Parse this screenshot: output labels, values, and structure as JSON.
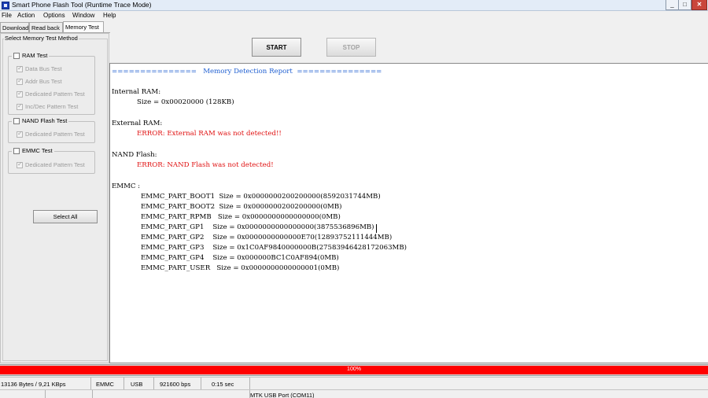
{
  "window": {
    "title": "Smart Phone Flash Tool (Runtime Trace Mode)",
    "minimize": "_",
    "maximize": "□",
    "close": "✕"
  },
  "menu": [
    "File",
    "Action",
    "Options",
    "Window",
    "Help"
  ],
  "tabs": [
    "Download",
    "Read back",
    "Memory Test"
  ],
  "left_panel": {
    "caption": "Select Memory Test Method",
    "ram_test": {
      "label": "RAM Test",
      "options": [
        "Data Bus Test",
        "Addr Bus Test",
        "Dedicated Pattern Test",
        "Inc/Dec Pattern Test"
      ]
    },
    "nand_test": {
      "label": "NAND Flash Test",
      "options": [
        "Dedicated Pattern Test"
      ]
    },
    "emmc_test": {
      "label": "EMMC Test",
      "options": [
        "Dedicated Pattern Test"
      ]
    },
    "select_all": "Select All"
  },
  "toolbar": {
    "start": "START",
    "stop": "STOP"
  },
  "report": {
    "header": "===============   Memory Detection Report  ===============",
    "internal_ram_label": "Internal RAM:",
    "internal_ram_size": "Size = 0x00020000 (128KB)",
    "external_ram_label": "External RAM:",
    "external_ram_error": "ERROR: External RAM was not detected!!",
    "nand_label": "NAND Flash:",
    "nand_error": "ERROR: NAND Flash was not detected!",
    "emmc_label": "EMMC :",
    "emmc_partitions": [
      "EMMC_PART_BOOT1  Size = 0x0000000200200000(8592031744MB)",
      "EMMC_PART_BOOT2  Size = 0x0000000200200000(0MB)",
      "EMMC_PART_RPMB   Size = 0x0000000000000000(0MB)",
      "EMMC_PART_GP1    Size = 0x0000000000000000(3875536896MB)",
      "EMMC_PART_GP2    Size = 0x0000000000000E70(12893752111444MB)",
      "EMMC_PART_GP3    Size = 0x1C0AF9840000000B(27583946428172063MB)",
      "EMMC_PART_GP4    Size = 0x000000BC1C0AF894(0MB)",
      "EMMC_PART_USER   Size = 0x0000000000000001(0MB)"
    ]
  },
  "progress": {
    "value": 1.0,
    "label": "100%",
    "color": "#ff0000"
  },
  "status": {
    "speed": "13136 Bytes / 9,21 KBps",
    "storage": "EMMC",
    "interface": "USB",
    "baud": "921600 bps",
    "elapsed": "0:15 sec",
    "port": "MTK USB Port (COM11)"
  },
  "colors": {
    "report_header": "#1f5fd1",
    "report_error": "#e01010",
    "progress": "#ff0000"
  }
}
